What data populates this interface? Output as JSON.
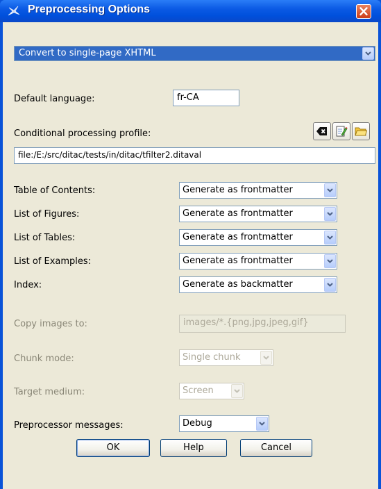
{
  "window": {
    "title": "Preprocessing Options"
  },
  "mode": {
    "selected": "Convert to single-page XHTML"
  },
  "default_language": {
    "label": "Default language:",
    "value": "fr-CA"
  },
  "profile": {
    "label": "Conditional processing profile:",
    "value": "file:/E:/src/ditac/tests/in/ditac/tfilter2.ditaval"
  },
  "lists": {
    "toc": {
      "label": "Table of Contents:",
      "value": "Generate as frontmatter"
    },
    "figures": {
      "label": "List of Figures:",
      "value": "Generate as frontmatter"
    },
    "tables": {
      "label": "List of Tables:",
      "value": "Generate as frontmatter"
    },
    "examples": {
      "label": "List of Examples:",
      "value": "Generate as frontmatter"
    },
    "index": {
      "label": "Index:",
      "value": "Generate as backmatter"
    }
  },
  "copy_images": {
    "label": "Copy images to:",
    "value": "images/*.{png,jpg,jpeg,gif}"
  },
  "chunk_mode": {
    "label": "Chunk mode:",
    "value": "Single chunk"
  },
  "target_medium": {
    "label": "Target medium:",
    "value": "Screen"
  },
  "messages": {
    "label": "Preprocessor messages:",
    "value": "Debug"
  },
  "buttons": {
    "ok": "OK",
    "help": "Help",
    "cancel": "Cancel"
  },
  "icons": {
    "window": "xmlmind-window-icon",
    "close": "close-icon",
    "clear": "clear-field-icon",
    "edit": "edit-file-icon",
    "open": "open-folder-icon",
    "dropdown": "chevron-down-icon"
  },
  "colors": {
    "titlebar": "#0b5ae4",
    "dialog_background": "#ece9d8",
    "selection": "#316ac5",
    "close_button": "#d8542e"
  }
}
